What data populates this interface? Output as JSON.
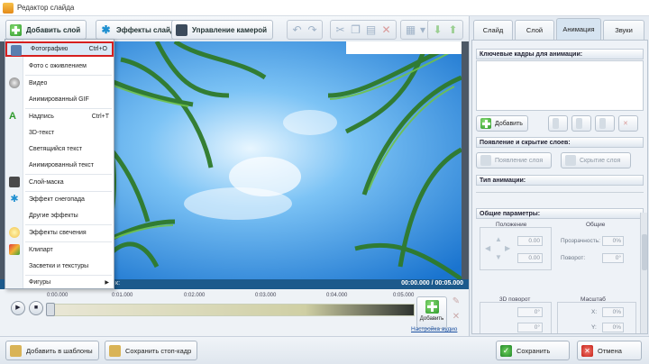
{
  "window": {
    "title": "Редактор слайда"
  },
  "toolbar": {
    "add_layer": "Добавить слой",
    "slide_effects": "Эффекты слайда",
    "camera_control": "Управление камерой"
  },
  "menu": {
    "items": [
      {
        "label": "Фотографию",
        "shortcut": "Ctrl+O",
        "icon": "photo-icon"
      },
      {
        "label": "Фото с оживлением",
        "shortcut": "",
        "icon": ""
      },
      {
        "label": "Видео",
        "shortcut": "",
        "icon": "video-reel-icon"
      },
      {
        "label": "Анимированный GIF",
        "shortcut": "",
        "icon": ""
      },
      {
        "label": "Надпись",
        "shortcut": "Ctrl+T",
        "icon": "text-a-icon"
      },
      {
        "label": "3D-текст",
        "shortcut": "",
        "icon": ""
      },
      {
        "label": "Светящийся текст",
        "shortcut": "",
        "icon": ""
      },
      {
        "label": "Анимированный текст",
        "shortcut": "",
        "icon": ""
      },
      {
        "label": "Слой-маска",
        "shortcut": "",
        "icon": "mask-icon"
      },
      {
        "label": "Эффект снегопада",
        "shortcut": "",
        "icon": "snowflake-icon"
      },
      {
        "label": "Другие эффекты",
        "shortcut": "",
        "icon": ""
      },
      {
        "label": "Эффекты свечения",
        "shortcut": "",
        "icon": "glow-icon"
      },
      {
        "label": "Клипарт",
        "shortcut": "",
        "icon": "clipart-icon"
      },
      {
        "label": "Засветки и текстуры",
        "shortcut": "",
        "icon": ""
      },
      {
        "label": "Фигуры",
        "shortcut": "",
        "icon": ""
      }
    ]
  },
  "timebar": {
    "label": "к:",
    "time": "00:00.000 / 00:05.000"
  },
  "timeline": {
    "ticks": [
      "0:00.000",
      "0:01.000",
      "0:02.000",
      "0:03.000",
      "0:04.000",
      "0:05.000"
    ],
    "add_label": "Добавить",
    "audio_link": "Настройка аудио",
    "position_fraction": 0
  },
  "footer": {
    "add_template": "Добавить в шаблоны",
    "save_frame": "Сохранить стоп-кадр",
    "save": "Сохранить",
    "cancel": "Отмена"
  },
  "panel": {
    "tabs": [
      "Слайд",
      "Слой",
      "Анимация",
      "Звуки"
    ],
    "active_tab": "Анимация",
    "keyframes_head": "Ключевые кадры для анимации:",
    "add_btn": "Добавить",
    "appear_head": "Появление и скрытие слоев:",
    "appear_btn": "Появление слоя",
    "hide_btn": "Скрытие слоя",
    "anim_type_head": "Тип анимации:",
    "general_head": "Общие параметры:",
    "position_label": "Положение",
    "common_label": "Общие",
    "pos_x": "0.00",
    "pos_y": "0.00",
    "opacity_label": "Прозрачность:",
    "opacity_value": "0%",
    "rotate_label": "Поворот:",
    "rotate_value": "0°",
    "rotate3d_label": "3D поворот",
    "scale_label": "Масштаб",
    "rot3d_a": "0°",
    "rot3d_b": "0°",
    "scale_x_label": "X:",
    "scale_x": "0%",
    "scale_y_label": "Y:",
    "scale_y": "0%"
  },
  "colors": {
    "highlight_border": "#d61f1f",
    "timebar": "#1c5a8c",
    "sky": "#2a8fe0"
  }
}
